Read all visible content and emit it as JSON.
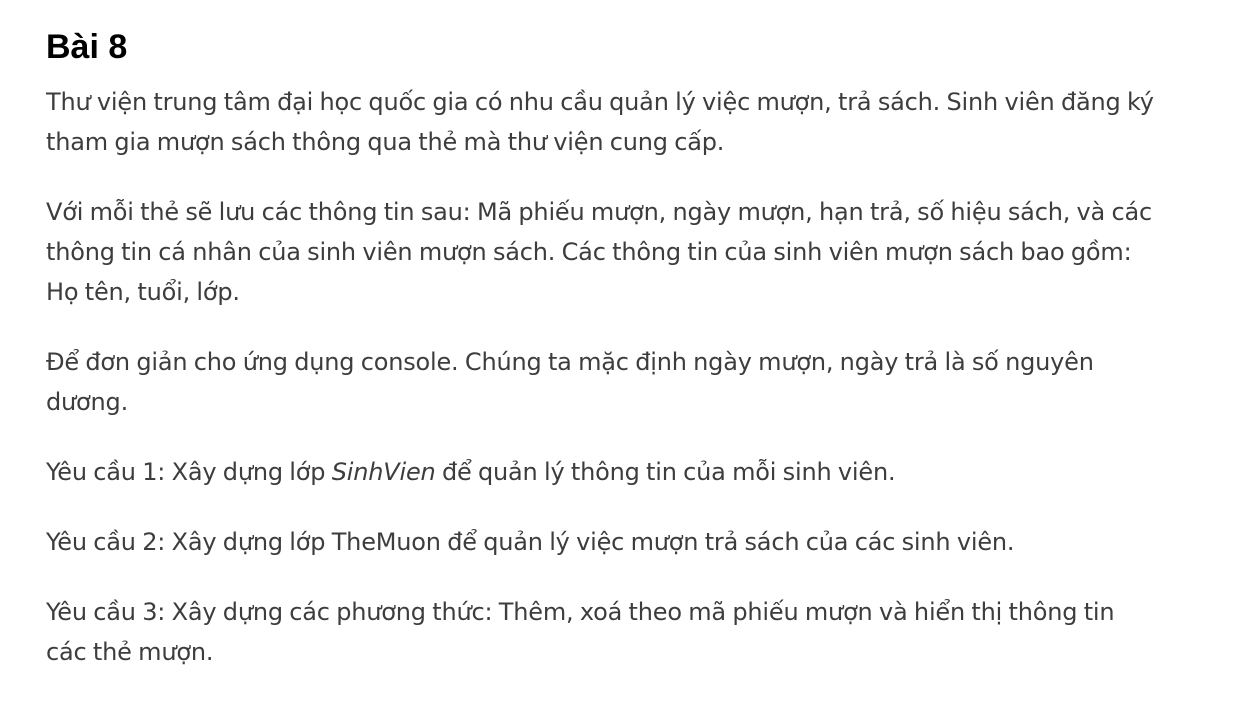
{
  "heading": "Bài 8",
  "paragraphs": {
    "p1": "Thư viện trung tâm đại học quốc gia có nhu cầu quản lý việc mượn, trả sách. Sinh viên đăng ký tham gia mượn sách thông qua thẻ mà thư viện cung cấp.",
    "p2": "Với mỗi thẻ sẽ lưu các thông tin sau: Mã phiếu mượn, ngày mượn, hạn trả, số hiệu sách, và các thông tin cá nhân của sinh viên mượn sách. Các thông tin của sinh viên mượn sách bao gồm: Họ tên, tuổi, lớp.",
    "p3": "Để đơn giản cho ứng dụng console. Chúng ta mặc định ngày mượn, ngày trả là số nguyên dương.",
    "p4_before": "Yêu cầu 1: Xây dựng lớp ",
    "p4_class": "SinhVien",
    "p4_after": " để quản lý thông tin của mỗi sinh viên.",
    "p5": "Yêu cầu 2: Xây dựng lớp TheMuon để quản lý việc mượn trả sách của các sinh viên.",
    "p6": "Yêu cầu 3: Xây dựng các phương thức: Thêm, xoá theo mã phiếu mượn và hiển thị thông tin các thẻ mượn."
  }
}
